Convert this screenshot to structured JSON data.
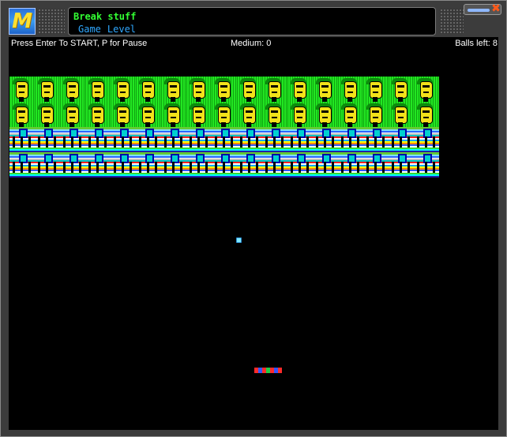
{
  "window": {
    "title": "Break stuff",
    "logo_letter": "M",
    "menu": [
      {
        "label": "Game"
      },
      {
        "label": "Level"
      }
    ],
    "controls": {
      "close_glyph": "✖"
    }
  },
  "status": {
    "instructions": "Press Enter To START, P for Pause",
    "score": "Medium: 0",
    "balls_left": "Balls left: 8"
  },
  "board": {
    "columns": 17,
    "rows": [
      "face",
      "face",
      "tech",
      "tech"
    ],
    "brick_types": {
      "face": "green-face-brick-icon",
      "tech": "striped-tech-brick-icon"
    },
    "colors": {
      "background": "#000000",
      "status_text": "#ffffff",
      "title": "#33ff33",
      "menu": "#2fa8ff"
    }
  }
}
